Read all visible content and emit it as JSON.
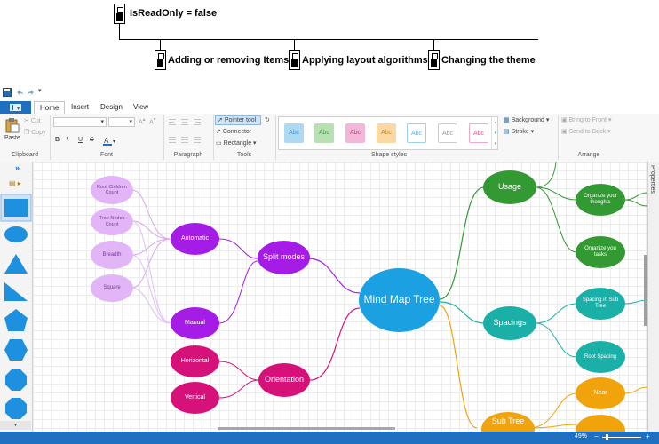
{
  "tree": {
    "root_label": "IsReadOnly = false",
    "children": [
      "Adding or removing Items",
      "Applying layout algorithms",
      "Changing the theme"
    ]
  },
  "ribbon": {
    "tabs": [
      "Home",
      "Insert",
      "Design",
      "View"
    ],
    "active_tab": "Home",
    "clipboard": {
      "paste": "Paste",
      "cut": "Cut",
      "copy": "Copy",
      "label": "Clipboard"
    },
    "font": {
      "label": "Font",
      "bold": "B",
      "italic": "I",
      "underline": "U",
      "strike": "S"
    },
    "paragraph": {
      "label": "Paragraph"
    },
    "tools": {
      "label": "Tools",
      "pointer": "Pointer tool",
      "connector": "Connector",
      "rectangle": "Rectangle"
    },
    "shape_styles": {
      "label": "Shape styles",
      "items": [
        "Abc",
        "Abc",
        "Abc",
        "Abc",
        "Abc",
        "Abc",
        "Abc"
      ]
    },
    "background": "Background",
    "stroke": "Stroke",
    "arrange": {
      "label": "Arrange",
      "bring_front": "Bring to Front",
      "send_back": "Send to Back"
    }
  },
  "props_label": "Properties",
  "zoom": "49%",
  "mindmap": {
    "root": "Mind Map Tree",
    "split_modes": "Split modes",
    "automatic": "Automatic",
    "manual": "Manual",
    "root_children_count": "Root Children Count",
    "tree_nodes_count": "Tree Nodes Count",
    "breadth": "Breadth",
    "square": "Square",
    "orientation": "Orientation",
    "horizontal": "Horizontal",
    "vertical": "Vertical",
    "usage": "Usage",
    "organize_thoughts": "Organize your thoughts",
    "organize_tasks": "Organize you tasks",
    "spacings": "Spacings",
    "spacing_sub_tree": "Spacing in Sub Tree",
    "root_spacing": "Root Spacing",
    "sub_tree": "Sub Tree",
    "near": "Near"
  },
  "colors": {
    "root": "#1ba1e2",
    "purple": "#a51ce6",
    "lilac": "#e2b6f6",
    "magenta": "#d6117a",
    "green": "#339933",
    "teal": "#1ab0a8",
    "orange": "#f0a30a",
    "accent": "#1e6fc0"
  }
}
